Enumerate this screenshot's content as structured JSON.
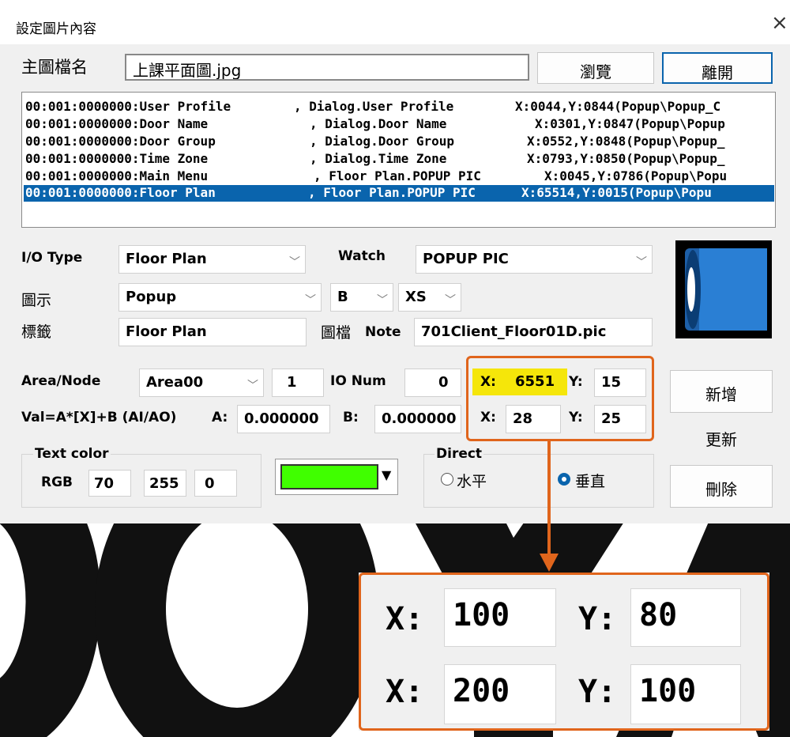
{
  "window": {
    "title": "設定圖片內容",
    "close": "×"
  },
  "main_image": {
    "label": "主圖檔名",
    "value": "上課平面圖.jpg"
  },
  "buttons": {
    "browse": "瀏覽",
    "leave": "離開",
    "add": "新增",
    "update": "更新",
    "delete": "刪除"
  },
  "list_rows": [
    {
      "a": "00:001:0000000:User Profile",
      "b": ", Dialog.User Profile",
      "c": "X:0044,Y:0844(Popup\\Popup_C"
    },
    {
      "a": "00:001:0000000:Door Name",
      "b": ", Dialog.Door Name",
      "c": "X:0301,Y:0847(Popup\\Popup"
    },
    {
      "a": "00:001:0000000:Door Group",
      "b": ", Dialog.Door Group",
      "c": "X:0552,Y:0848(Popup\\Popup_"
    },
    {
      "a": "00:001:0000000:Time Zone",
      "b": ", Dialog.Time Zone",
      "c": "X:0793,Y:0850(Popup\\Popup_"
    },
    {
      "a": "00:001:0000000:Main Menu",
      "b": ", Floor Plan.POPUP PIC",
      "c": "X:0045,Y:0786(Popup\\Popu"
    },
    {
      "a": "00:001:0000000:Floor Plan",
      "b": ", Floor Plan.POPUP PIC",
      "c": "X:65514,Y:0015(Popup\\Popu"
    }
  ],
  "form": {
    "io_type_label": "I/O Type",
    "io_type": "Floor Plan",
    "watch_label": "Watch",
    "watch": "POPUP PIC",
    "icon_label": "圖示",
    "icon": "Popup",
    "style1": "B",
    "style2": "XS",
    "tag_label": "標籤",
    "tag": "Floor Plan",
    "file_label": "圖檔",
    "note_label": "Note",
    "file": "701Client_Floor01D.pic",
    "area_node_label": "Area/Node",
    "area": "Area00",
    "node": "1",
    "io_num_label": "IO Num",
    "io_num": "0",
    "x1_label": "X:",
    "x1": "6551",
    "y1_label": "Y:",
    "y1": "15",
    "x2_label": "X:",
    "x2": "28",
    "y2_label": "Y:",
    "y2": "25",
    "val_label": "Val=A*[X]+B (AI/AO)",
    "a_label": "A:",
    "a": "0.000000",
    "b_label": "B:",
    "b": "0.000000",
    "text_color_label": "Text color",
    "rgb_label": "RGB",
    "r": "70",
    "g": "255",
    "bl": "0",
    "swatch_color": "#40ff00",
    "direct_label": "Direct",
    "horizontal": "水平",
    "vertical": "垂直"
  },
  "zoom": {
    "x1_label": "X:",
    "x1": "100",
    "y1_label": "Y:",
    "y1": "80",
    "x2_label": "X:",
    "x2": "200",
    "y2_label": "Y:",
    "y2": "100"
  },
  "watermark": "SOYAL",
  "colors": {
    "selection": "#0a64ad",
    "highlight": "#e0651c",
    "callout_fill": "#f5e60a"
  }
}
